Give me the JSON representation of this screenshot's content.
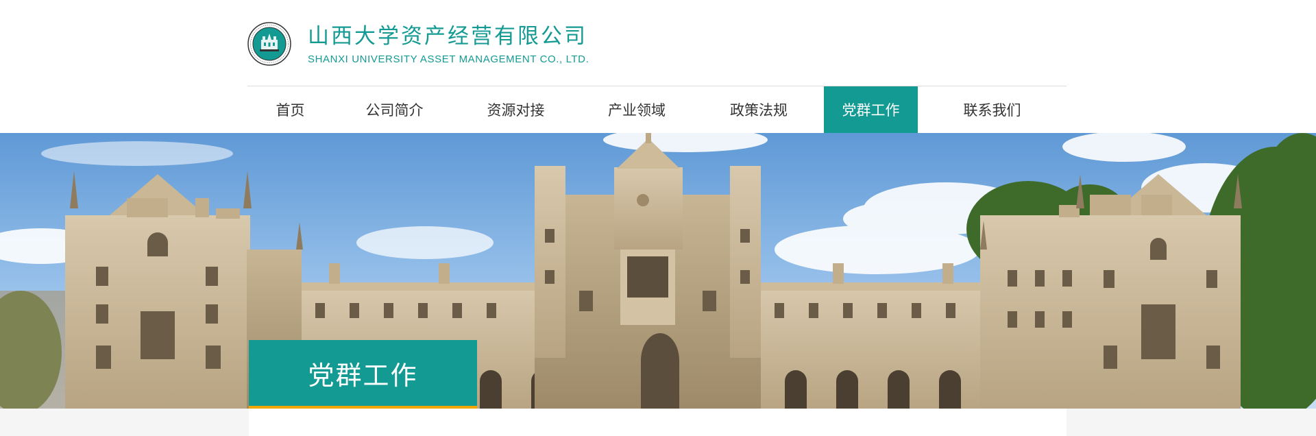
{
  "brand": {
    "name_cn": "山西大学资产经营有限公司",
    "name_en": "SHANXI UNIVERSITY ASSET MANAGEMENT CO., LTD.",
    "seal_icon": "university-seal-icon",
    "accent_color": "#139a93"
  },
  "nav": {
    "items": [
      {
        "label": "首页",
        "active": false
      },
      {
        "label": "公司简介",
        "active": false
      },
      {
        "label": "资源对接",
        "active": false
      },
      {
        "label": "产业领域",
        "active": false
      },
      {
        "label": "政策法规",
        "active": false
      },
      {
        "label": "党群工作",
        "active": true
      },
      {
        "label": "联系我们",
        "active": false
      }
    ]
  },
  "banner": {
    "image_icon": "campus-building-photo",
    "section_title": "党群工作",
    "underline_color": "#f0a500"
  }
}
